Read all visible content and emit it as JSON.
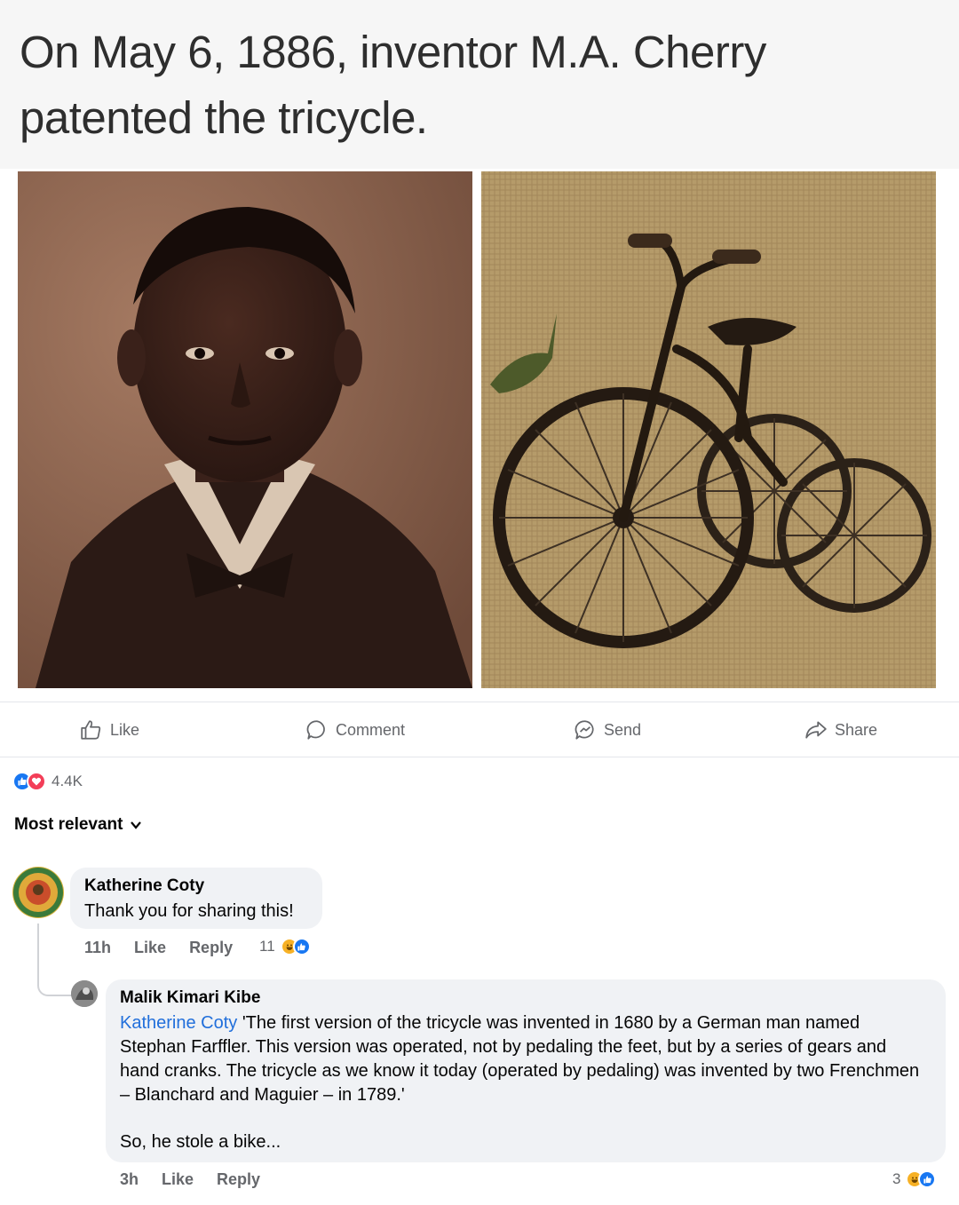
{
  "post": {
    "headline": "On May 6, 1886, inventor M.A. Cherry patented the tricycle."
  },
  "actions": {
    "like": "Like",
    "comment": "Comment",
    "send": "Send",
    "share": "Share"
  },
  "reactions": {
    "icons": [
      "like",
      "love"
    ],
    "count": "4.4K"
  },
  "sort": {
    "label": "Most relevant"
  },
  "comments": [
    {
      "author": "Katherine Coty",
      "text": "Thank you for sharing this!",
      "time": "11h",
      "like_label": "Like",
      "reply_label": "Reply",
      "reaction_count": "11",
      "reaction_icons": [
        "haha",
        "like"
      ]
    },
    {
      "author": "Malik Kimari Kibe",
      "mention": "Katherine Coty",
      "text": "'The first version of the tricycle was invented in 1680 by a German man named Stephan Farffler. This version was operated, not by pedaling the feet, but by a series of gears and hand cranks. The tricycle as we know it today (operated by pedaling) was invented by two Frenchmen – Blanchard and Maguier – in 1789.'",
      "text2": "So, he stole a bike...",
      "time": "3h",
      "like_label": "Like",
      "reply_label": "Reply",
      "reaction_count": "3",
      "reaction_icons": [
        "haha",
        "like"
      ]
    }
  ],
  "colors": {
    "accent": "#1877f2",
    "love": "#f33e58",
    "haha": "#f7b125",
    "secondary_text": "#65676b",
    "bubble": "#f0f2f5",
    "mention": "#216fdb"
  }
}
